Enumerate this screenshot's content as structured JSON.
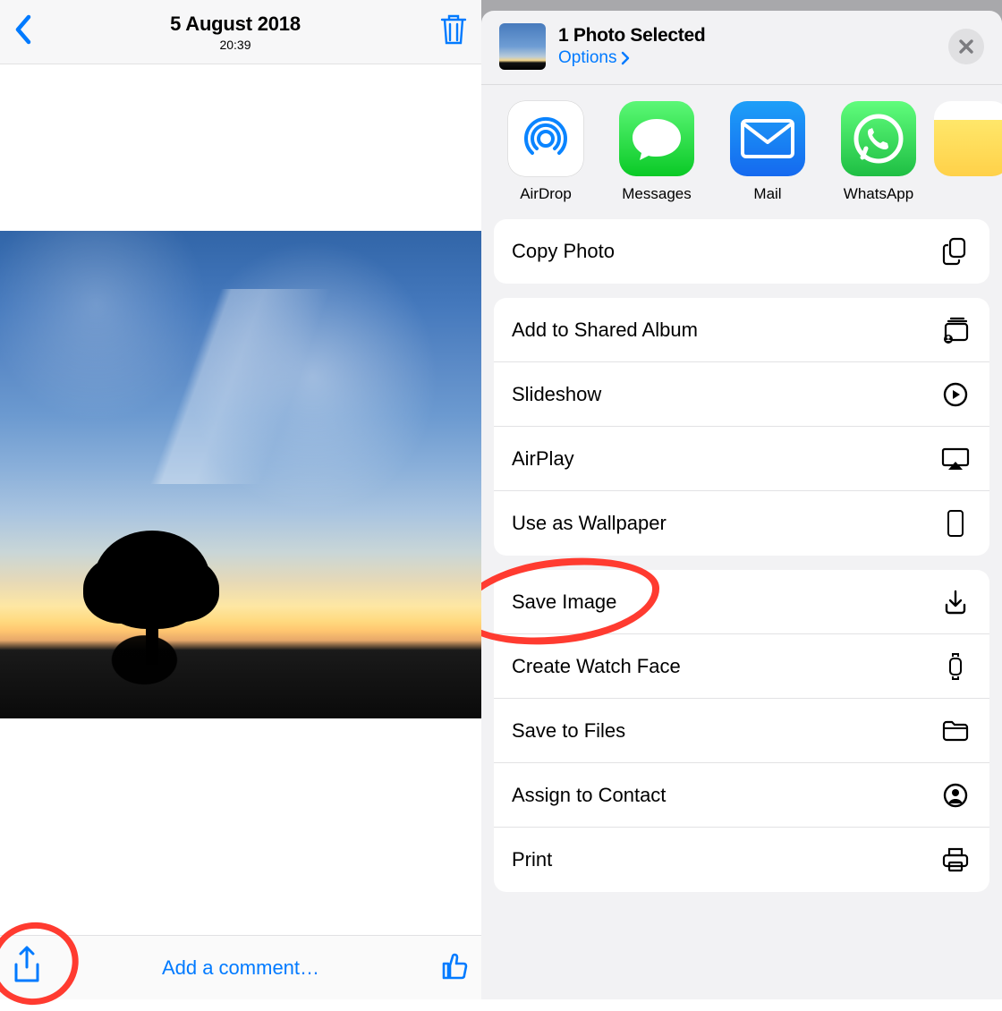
{
  "left": {
    "header": {
      "date": "5 August 2018",
      "time": "20:39"
    },
    "footer": {
      "comment_link": "Add a comment…"
    }
  },
  "right": {
    "sheet": {
      "title": "1 Photo Selected",
      "options_label": "Options"
    },
    "apps": [
      {
        "name": "AirDrop"
      },
      {
        "name": "Messages"
      },
      {
        "name": "Mail"
      },
      {
        "name": "WhatsApp"
      }
    ],
    "action_groups": [
      [
        {
          "label": "Copy Photo",
          "icon": "copy"
        }
      ],
      [
        {
          "label": "Add to Shared Album",
          "icon": "shared-album"
        },
        {
          "label": "Slideshow",
          "icon": "play-circle"
        },
        {
          "label": "AirPlay",
          "icon": "airplay"
        },
        {
          "label": "Use as Wallpaper",
          "icon": "phone"
        }
      ],
      [
        {
          "label": "Save Image",
          "icon": "download",
          "highlighted": true
        },
        {
          "label": "Create Watch Face",
          "icon": "watch"
        },
        {
          "label": "Save to Files",
          "icon": "folder"
        },
        {
          "label": "Assign to Contact",
          "icon": "contact"
        },
        {
          "label": "Print",
          "icon": "print"
        }
      ]
    ]
  }
}
